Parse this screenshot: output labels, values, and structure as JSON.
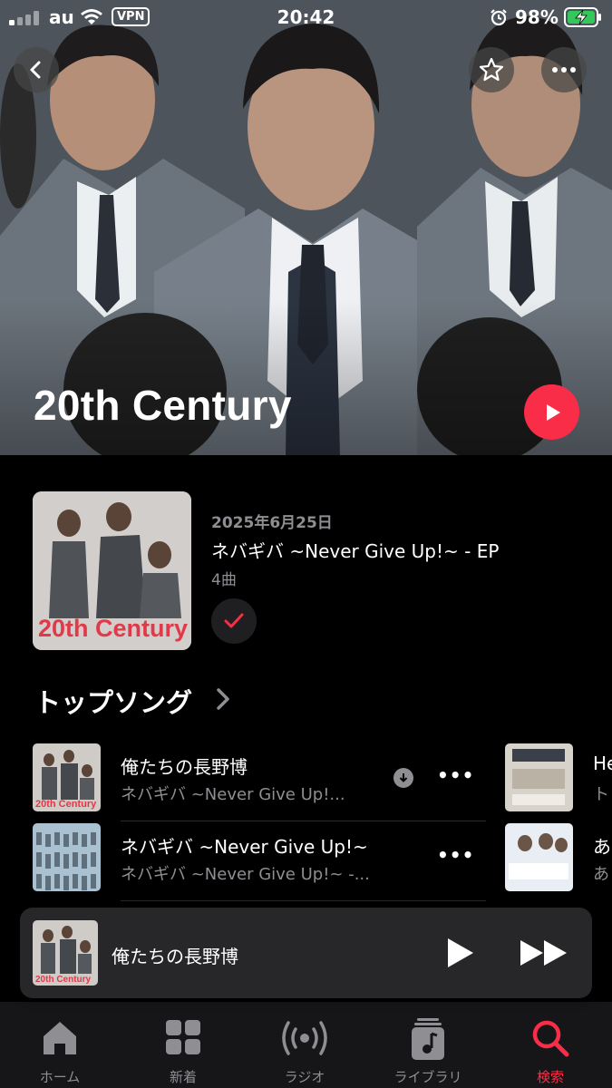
{
  "status_bar": {
    "carrier": "au",
    "vpn": "VPN",
    "time": "20:42",
    "battery": "98%"
  },
  "artist": {
    "name": "20th Century",
    "play_label": "Play",
    "back_label": "Back",
    "favorite_label": "Favorite",
    "more_label": "More"
  },
  "latest_release": {
    "art_text": "20th Century",
    "date": "2025年6月25日",
    "title": "ネバギバ ~Never Give Up!~ - EP",
    "track_count": "4曲",
    "added": true
  },
  "top_songs": {
    "heading": "トップソング",
    "items": [
      {
        "title": "俺たちの長野博",
        "album": "ネバギバ ~Never Give Up!...",
        "downloaded": true,
        "more": "•••"
      },
      {
        "title": "ネバギバ ~Never Give Up!~",
        "album": "ネバギバ ~Never Give Up!~ -...",
        "downloaded": false,
        "more": "•••"
      }
    ],
    "next_column": [
      {
        "title": "He",
        "sub": "ト"
      },
      {
        "title": "あ",
        "sub": "あ"
      }
    ]
  },
  "now_playing": {
    "title": "俺たちの長野博",
    "thumb_text": "20th Century"
  },
  "tabs": [
    {
      "label": "ホーム",
      "icon": "home-icon",
      "active": false
    },
    {
      "label": "新着",
      "icon": "grid-icon",
      "active": false
    },
    {
      "label": "ラジオ",
      "icon": "radio-icon",
      "active": false
    },
    {
      "label": "ライブラリ",
      "icon": "library-icon",
      "active": false
    },
    {
      "label": "検索",
      "icon": "search-icon",
      "active": true
    }
  ],
  "colors": {
    "accent": "#fa2d48",
    "secondary_text": "#8e8e93",
    "background": "#000000"
  }
}
